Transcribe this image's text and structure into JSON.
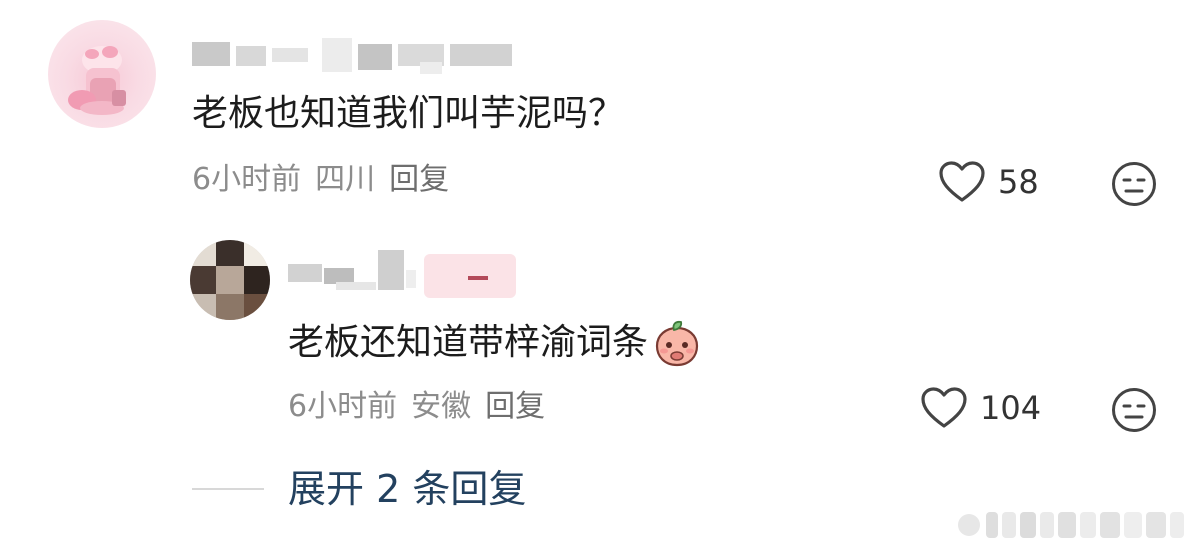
{
  "comments": [
    {
      "text": "老板也知道我们叫芋泥吗？",
      "time": "6小时前",
      "location": "四川",
      "reply_label": "回复",
      "likes": "58"
    }
  ],
  "replies": [
    {
      "text": "老板还知道带梓渝词条",
      "time": "6小时前",
      "location": "安徽",
      "reply_label": "回复",
      "likes": "104"
    }
  ],
  "expand": {
    "label": "展开 2 条回复"
  },
  "icons": {
    "like": "heart-outline-icon",
    "dislike": "meh-face-icon",
    "emoji": "peach-emoji-icon"
  },
  "colors": {
    "text_primary": "#1c1c1c",
    "text_meta": "#8c8c8c",
    "expand_link": "#23415f"
  }
}
